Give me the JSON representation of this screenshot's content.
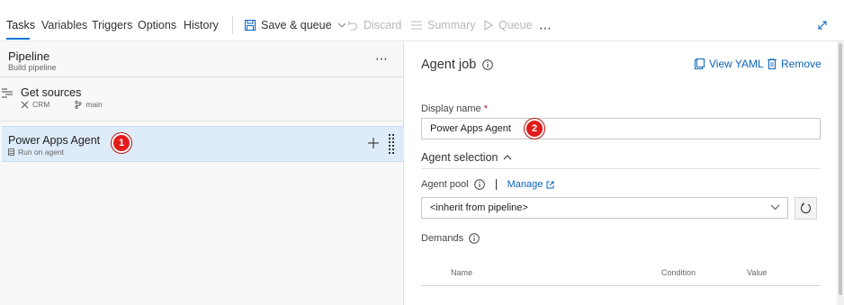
{
  "toolbar": {
    "tabs": [
      {
        "label": "Tasks",
        "active": true
      },
      {
        "label": "Variables"
      },
      {
        "label": "Triggers"
      },
      {
        "label": "Options"
      },
      {
        "label": "History"
      }
    ],
    "save_queue": "Save & queue",
    "discard": "Discard",
    "summary": "Summary",
    "queue": "Queue",
    "more": "⋯"
  },
  "pipeline": {
    "title": "Pipeline",
    "subtitle": "Build pipeline",
    "more": "⋯"
  },
  "get_sources": {
    "title": "Get sources",
    "repo": "CRM",
    "branch": "main"
  },
  "agent_job_item": {
    "title": "Power Apps Agent",
    "subtitle": "Run on agent",
    "badge": "1"
  },
  "detail": {
    "title": "Agent job",
    "view_yaml": "View YAML",
    "remove": "Remove",
    "display_name_label": "Display name",
    "required_marker": "*",
    "display_name_value": "Power Apps Agent",
    "badge": "2",
    "agent_selection": "Agent selection",
    "agent_pool_label": "Agent pool",
    "manage": "Manage",
    "agent_pool_value": "<inherit from pipeline>",
    "demands_label": "Demands",
    "columns": [
      "Name",
      "Condition",
      "Value"
    ]
  },
  "colors": {
    "accent": "#0078d4",
    "link": "#0a64b8",
    "badge": "#e21b1b",
    "selected_row": "#deecf9"
  }
}
